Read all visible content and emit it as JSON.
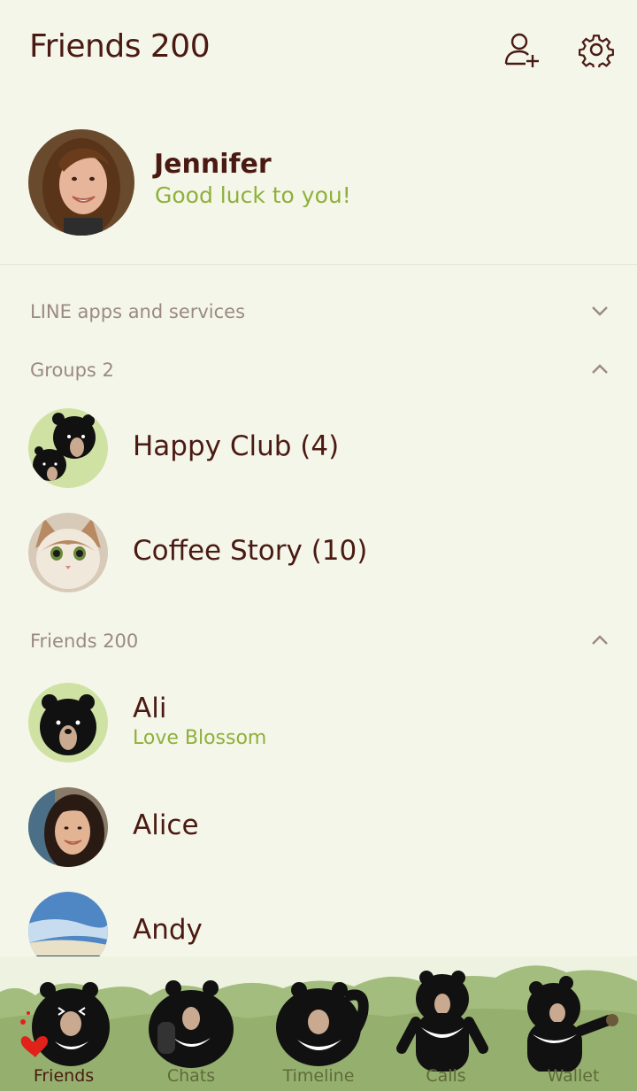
{
  "header": {
    "title": "Friends 200",
    "add_friend_icon": "add-friend-icon",
    "settings_icon": "gear-icon"
  },
  "profile": {
    "name": "Jennifer",
    "status": "Good luck to you!"
  },
  "sections": {
    "services": {
      "label": "LINE apps and services",
      "state": "collapsed"
    },
    "groups": {
      "label": "Groups 2",
      "state": "expanded"
    },
    "friends": {
      "label": "Friends 200",
      "state": "expanded"
    }
  },
  "groups": [
    {
      "name": "Happy Club (4)"
    },
    {
      "name": "Coffee Story (10)"
    }
  ],
  "friends": [
    {
      "name": "Ali",
      "status": "Love Blossom"
    },
    {
      "name": "Alice",
      "status": ""
    },
    {
      "name": "Andy",
      "status": ""
    }
  ],
  "tabs": [
    {
      "label": "Friends",
      "active": true
    },
    {
      "label": "Chats",
      "active": false
    },
    {
      "label": "Timeline",
      "active": false
    },
    {
      "label": "Calls",
      "active": false
    },
    {
      "label": "Wallet",
      "active": false
    }
  ],
  "colors": {
    "background": "#f4f6ea",
    "text": "#4a1a12",
    "accent_green": "#8fb03a",
    "section_text": "#9b8a83",
    "tab_bg_green": "#9bb575"
  }
}
